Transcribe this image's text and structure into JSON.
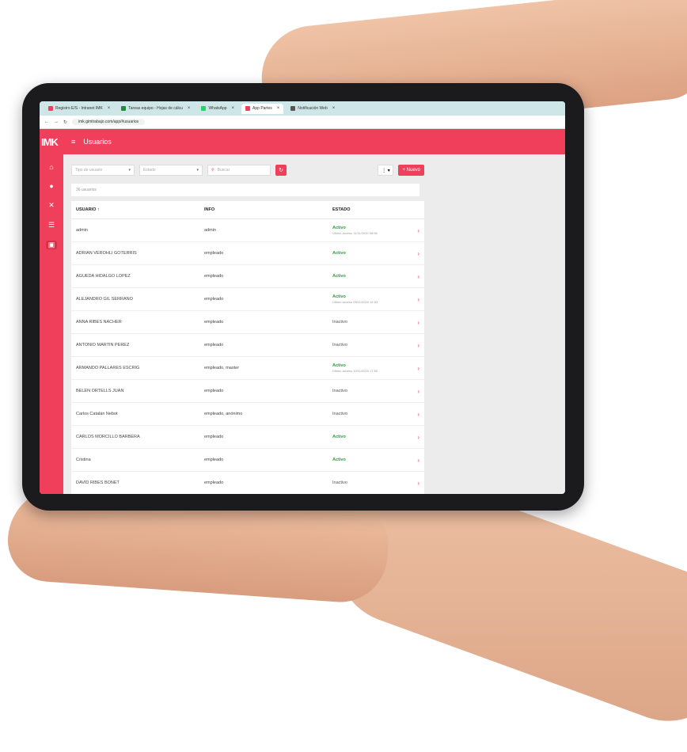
{
  "browser": {
    "tabs": [
      {
        "label": "Registro E/S - Intranet IMK",
        "color": "#ef3f5b",
        "active": false
      },
      {
        "label": "Tareas equipo - Hojas de cálcu",
        "color": "#1e8e3e",
        "active": false
      },
      {
        "label": "WhatsApp",
        "color": "#25d366",
        "active": false
      },
      {
        "label": "App Partes",
        "color": "#ef3f5b",
        "active": true
      },
      {
        "label": "Notificación Web",
        "color": "#555555",
        "active": false
      }
    ],
    "url": "imk.gimtrabajo.com/app/#usuarios"
  },
  "app": {
    "logo": "IMK",
    "title": "Usuarios",
    "accent": "#ef3f5b"
  },
  "filters": {
    "tipo_placeholder": "Tipo de usuario",
    "estado_placeholder": "Estado",
    "search_placeholder": "Buscar",
    "new_label": "+ Nuevo"
  },
  "count_text": "36 usuarios",
  "table": {
    "headers": [
      "USUARIO ↑",
      "INFO",
      "ESTADO"
    ],
    "rows": [
      {
        "usuario": "admin",
        "info": "admin",
        "estado": "Activo",
        "sub": "Último acceso 11/11/2020 08:56"
      },
      {
        "usuario": "ADRIAN VEROHLI GOTERRIS",
        "info": "empleado",
        "estado": "Activo",
        "sub": ""
      },
      {
        "usuario": "AGUEDA HIDALGO LOPEZ",
        "info": "empleado",
        "estado": "Activo",
        "sub": ""
      },
      {
        "usuario": "ALEJANDRO GIL SERRANO",
        "info": "empleado",
        "estado": "Activo",
        "sub": "Último acceso 09/11/2020 12:53"
      },
      {
        "usuario": "ANNA RIBES NACHER",
        "info": "empleado",
        "estado": "Inactivo",
        "sub": ""
      },
      {
        "usuario": "ANTONIO MARTIN PEREZ",
        "info": "empleado",
        "estado": "Inactivo",
        "sub": ""
      },
      {
        "usuario": "ARMANDO PALLARES ESCRIG",
        "info": "empleado, master",
        "estado": "Activo",
        "sub": "Último acceso 10/11/2020 17:50"
      },
      {
        "usuario": "BELEN ORTELLS JUAN",
        "info": "empleado",
        "estado": "Inactivo",
        "sub": ""
      },
      {
        "usuario": "Carlos Catalán Nebot",
        "info": "empleado, anónimo",
        "estado": "Inactivo",
        "sub": ""
      },
      {
        "usuario": "CARLOS MORCILLO BARBERA",
        "info": "empleado",
        "estado": "Activo",
        "sub": ""
      },
      {
        "usuario": "Cristina",
        "info": "empleado",
        "estado": "Activo",
        "sub": ""
      },
      {
        "usuario": "DAVID RIBES BONET",
        "info": "empleado",
        "estado": "Inactivo",
        "sub": ""
      }
    ]
  }
}
